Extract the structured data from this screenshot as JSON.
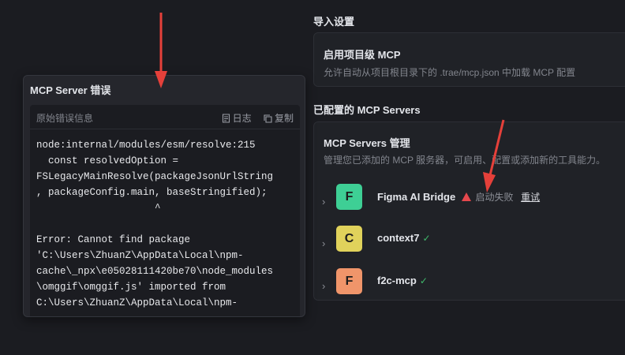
{
  "import_settings": {
    "title": "导入设置",
    "project_mcp_title": "启用项目级 MCP",
    "project_mcp_desc": "允许自动从项目根目录下的 .trae/mcp.json 中加载 MCP 配置"
  },
  "configured": {
    "title": "已配置的 MCP Servers",
    "manage_title": "MCP Servers 管理",
    "manage_desc": "管理您已添加的 MCP 服务器，可启用、配置或添加新的工具能力。"
  },
  "servers": [
    {
      "letter": "F",
      "name": "Figma AI Bridge",
      "color": "#3ecf95",
      "status": "启动失败",
      "retry": "重试",
      "state": "error"
    },
    {
      "letter": "C",
      "name": "context7",
      "color": "#e0d25b",
      "status_icon": "check-icon",
      "state": "ok"
    },
    {
      "letter": "F",
      "name": "f2c-mcp",
      "color": "#f0956a",
      "status_icon": "check-icon",
      "state": "ok"
    }
  ],
  "error_panel": {
    "title": "MCP Server 错误",
    "subtitle": "原始错误信息",
    "log_label": "日志",
    "copy_label": "复制",
    "code": "node:internal/modules/esm/resolve:215\n  const resolvedOption =\nFSLegacyMainResolve(packageJsonUrlString\n, packageConfig.main, baseStringified);\n                    ^\n\nError: Cannot find package\n'C:\\Users\\ZhuanZ\\AppData\\Local\\npm-\ncache\\_npx\\e05028111420be70\\node_modules\n\\omggif\\omggif.js' imported from\nC:\\Users\\ZhuanZ\\AppData\\Local\\npm-"
  },
  "colors": {
    "background": "#1b1c21",
    "card": "#202227",
    "success": "#3fb96b",
    "warning": "#e5484d",
    "annotation_arrow": "#e5403a"
  }
}
